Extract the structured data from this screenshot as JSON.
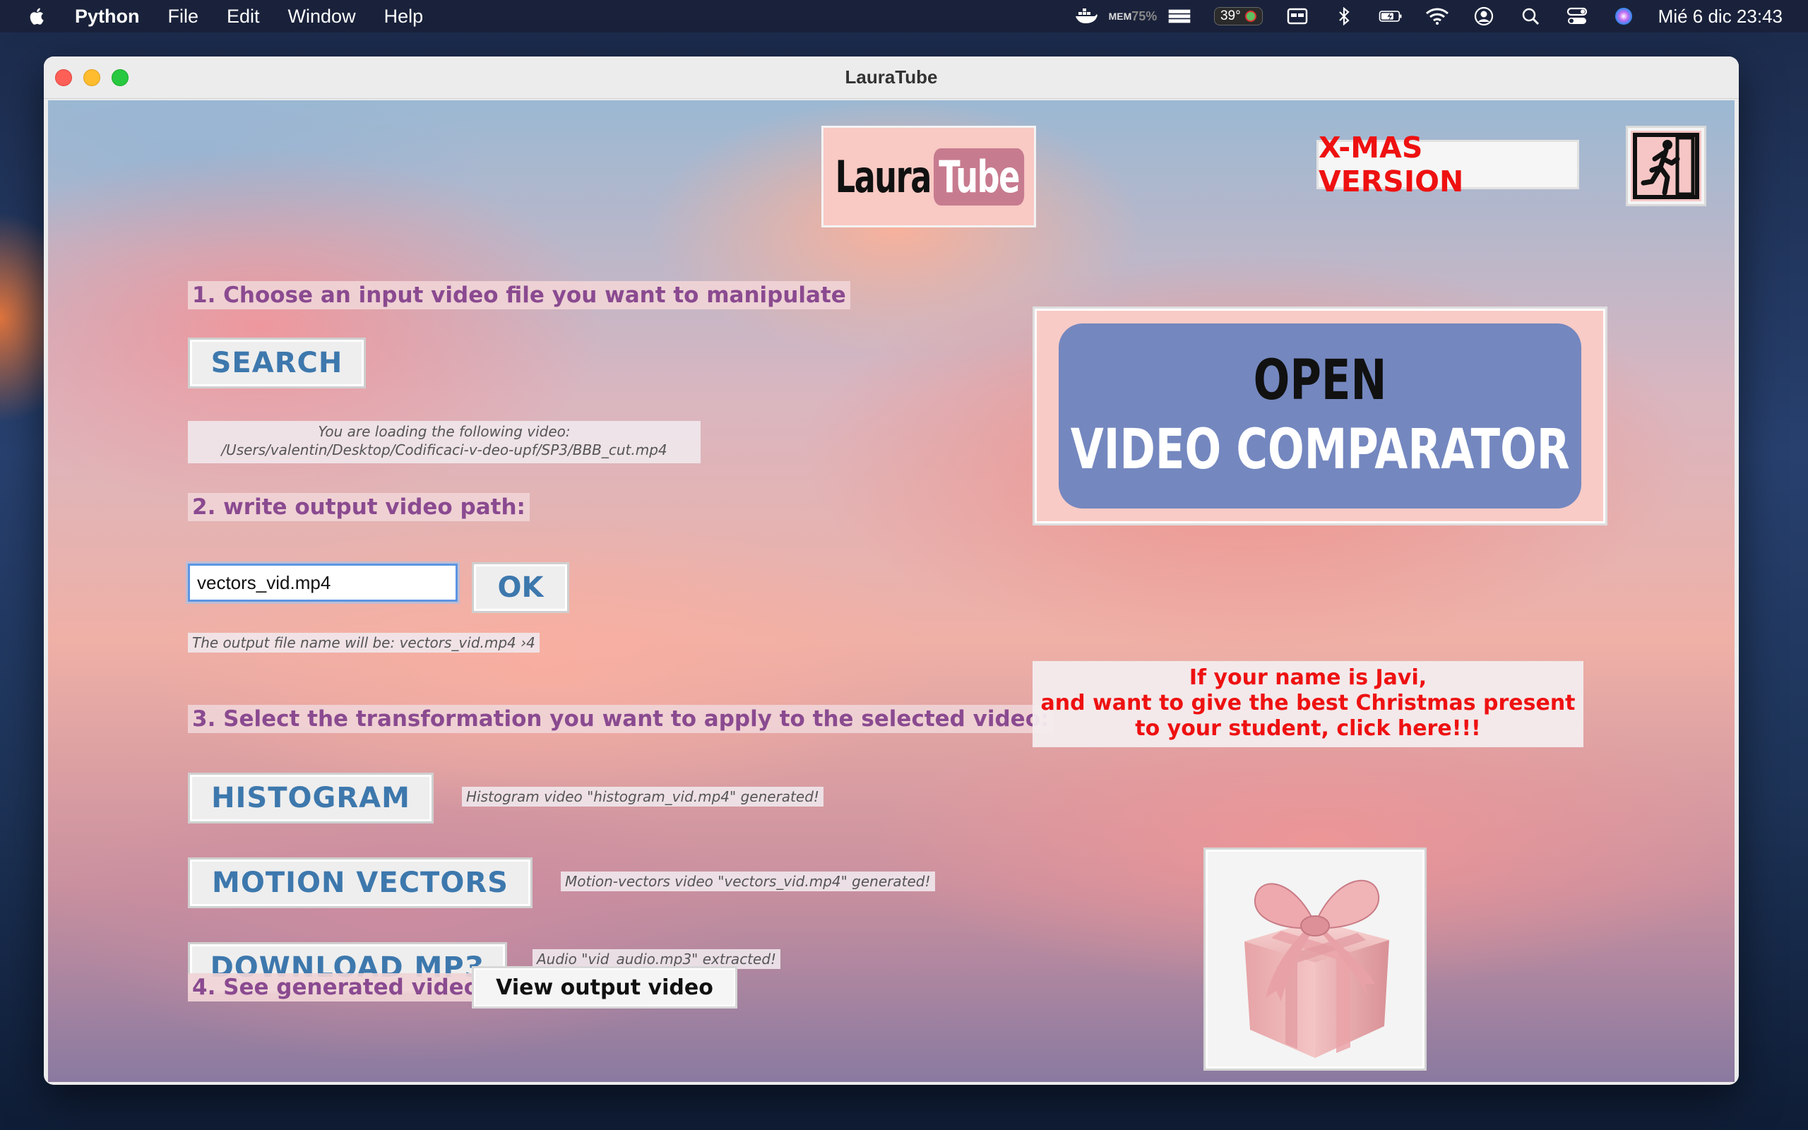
{
  "menubar": {
    "app_name": "Python",
    "menus": [
      "File",
      "Edit",
      "Window",
      "Help"
    ],
    "temperature": "39°",
    "memory_label": "MEM",
    "memory_value": "75%",
    "clock": "Mié 6 dic  23:43"
  },
  "window": {
    "title": "LauraTube"
  },
  "logo": {
    "part1": "Laura",
    "part2": "Tube"
  },
  "xmas_label": "X-MAS VERSION",
  "exit_icon": "exit-running-man-icon",
  "steps": {
    "step1": "1. Choose an input video file you want to manipulate",
    "step2": "2. write output video path:",
    "step3": "3. Select the transformation you want to apply to the selected video:",
    "step4": "4. See generated video"
  },
  "search_button": "SEARCH",
  "loading_note": {
    "line1": "You are loading the following video:",
    "line2": "/Users/valentin/Desktop/Codificaci-v-deo-upf/SP3/BBB_cut.mp4"
  },
  "output_input": {
    "value": "vectors_vid.mp4"
  },
  "ok_button": "OK",
  "output_note": "The output file name will be: vectors_vid.mp4 ›4",
  "transform_buttons": {
    "histogram": "HISTOGRAM",
    "motion_vectors": "MOTION VECTORS",
    "download_mp3": "DOWNLOAD MP3"
  },
  "status_notes": {
    "histogram": "Histogram video \"histogram_vid.mp4\" generated!",
    "motion_vectors": "Motion-vectors video \"vectors_vid.mp4\" generated!",
    "audio": "Audio \"vid_audio.mp3\" extracted!"
  },
  "view_button": "View output video",
  "comparator": {
    "line1": "OPEN",
    "line2": "VIDEO COMPARATOR"
  },
  "javi_message": {
    "line1": "If your name is Javi,",
    "line2": "and want to give the best Christmas present",
    "line3": "to your student, click here!!!"
  },
  "gift_icon": "pink-gift-box-icon",
  "colors": {
    "accent_blue": "#3d78ad",
    "label_purple": "#8a4a90",
    "alert_red": "#ee1111",
    "comparator_blue": "#7487bf",
    "logo_pink": "#f9c9c4"
  }
}
